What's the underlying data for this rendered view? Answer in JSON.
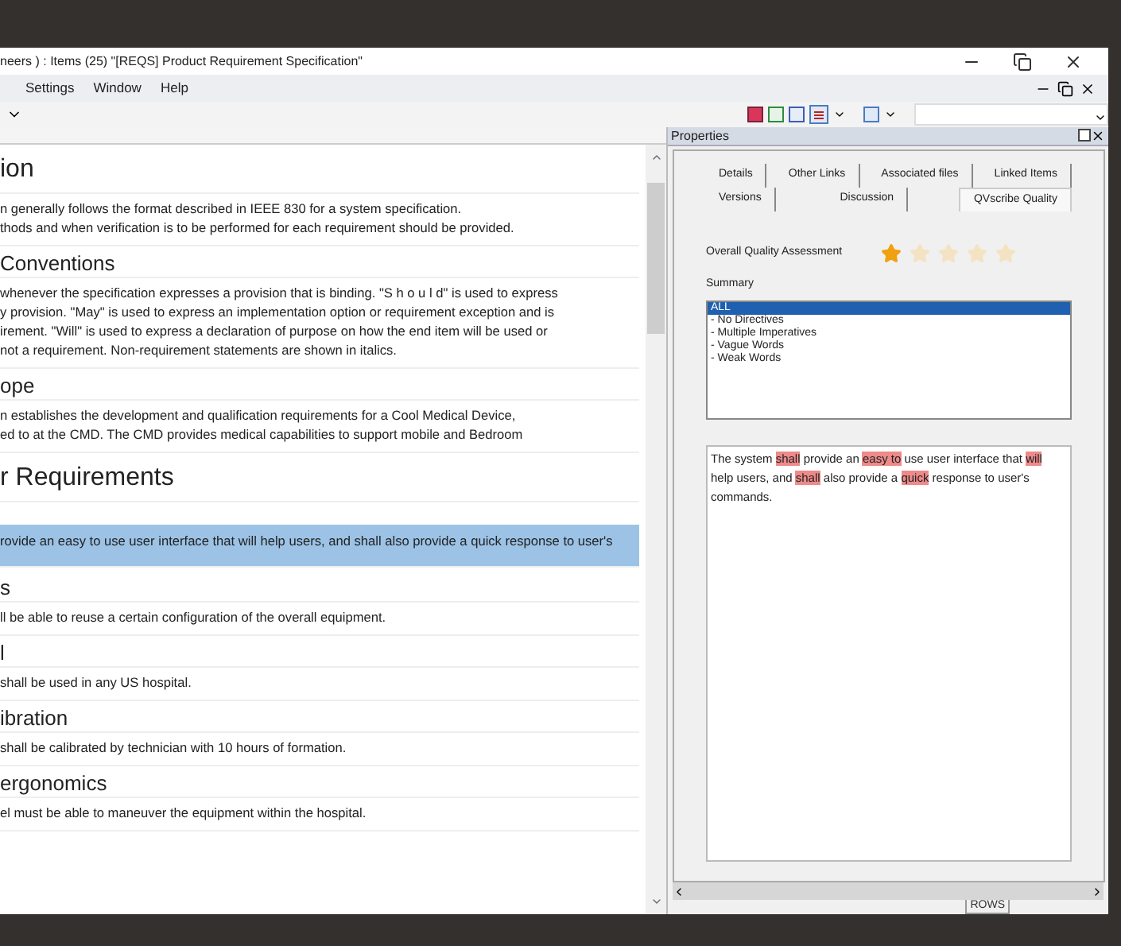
{
  "window": {
    "title": "neers ) : Items (25) \"[REQS] Product Requirement Specification\""
  },
  "menu": [
    "Settings",
    "Window",
    "Help"
  ],
  "document": {
    "rows": [
      {
        "kind": "title",
        "text": "ion",
        "selected": false
      },
      {
        "kind": "text",
        "lines": [
          "n generally follows the format described in IEEE 830 for a system specification.",
          "thods and when verification is to be performed for each requirement should be provided."
        ],
        "selected": false
      },
      {
        "kind": "heading",
        "text": "Conventions",
        "selected": false
      },
      {
        "kind": "text",
        "lines": [
          "whenever the specification expresses a provision that is binding. \"S h o u l d\" is used to express",
          "y provision. \"May\" is used to express an implementation option or requirement exception and is",
          "irement.  \"Will\" is used to express a declaration of purpose on how the end item will be used or",
          "not a requirement.  Non-requirement statements are shown in italics."
        ],
        "selected": false
      },
      {
        "kind": "heading",
        "text": "ope",
        "selected": false
      },
      {
        "kind": "text",
        "lines": [
          "n establishes the development and qualification requirements for a Cool Medical Device,",
          "ed to at the CMD.  The CMD provides medical capabilities to support mobile and Bedroom"
        ],
        "selected": false
      },
      {
        "kind": "title",
        "text": "r Requirements",
        "selected": false
      },
      {
        "kind": "text",
        "lines": [
          "rovide an easy to use user interface that will help users, and shall also provide a quick response to user's"
        ],
        "selected": true
      },
      {
        "kind": "heading",
        "text": "s",
        "selected": false
      },
      {
        "kind": "text",
        "lines": [
          "ll be able to reuse a certain configuration of the overall equipment."
        ],
        "selected": false
      },
      {
        "kind": "heading",
        "text": "l",
        "selected": false
      },
      {
        "kind": "text",
        "lines": [
          "shall be used in any US hospital."
        ],
        "selected": false
      },
      {
        "kind": "heading",
        "text": "ibration",
        "selected": false
      },
      {
        "kind": "text",
        "lines": [
          "shall be calibrated by technician with 10 hours of formation."
        ],
        "selected": false
      },
      {
        "kind": "heading",
        "text": "ergonomics",
        "selected": false
      },
      {
        "kind": "text",
        "lines": [
          "el must be able to maneuver the equipment within the hospital."
        ],
        "selected": false
      }
    ]
  },
  "properties": {
    "title": "Properties",
    "tab_rows": [
      [
        {
          "label": "Details",
          "selected": false
        },
        {
          "label": "Other Links",
          "selected": false
        },
        {
          "label": "Associated files",
          "selected": false
        },
        {
          "label": "Linked Items",
          "selected": false
        }
      ],
      [
        {
          "label": "Versions",
          "selected": false
        },
        {
          "label": "Discussion",
          "selected": false
        },
        {
          "label": "QVscribe Quality",
          "selected": true
        }
      ]
    ],
    "assessment_label": "Overall Quality Assessment",
    "stars": 1,
    "summary_label": "Summary",
    "summary_items": [
      {
        "label": "ALL",
        "selected": true
      },
      {
        "label": "- No Directives",
        "selected": false
      },
      {
        "label": "- Multiple Imperatives",
        "selected": false
      },
      {
        "label": "- Vague Words",
        "selected": false
      },
      {
        "label": "- Weak Words",
        "selected": false
      }
    ],
    "analysis": [
      {
        "text": "The system ",
        "flagged": false
      },
      {
        "text": "shall",
        "flagged": true
      },
      {
        "text": " provide an ",
        "flagged": false
      },
      {
        "text": "easy to",
        "flagged": true
      },
      {
        "text": " use user interface that ",
        "flagged": false
      },
      {
        "text": "will",
        "flagged": true
      },
      {
        "text": " help users, and ",
        "flagged": false
      },
      {
        "text": "shall",
        "flagged": true
      },
      {
        "text": " also provide a ",
        "flagged": false
      },
      {
        "text": "quick",
        "flagged": true
      },
      {
        "text": " response to user's commands.",
        "flagged": false
      }
    ]
  },
  "status_bar": [
    "ROWS"
  ]
}
